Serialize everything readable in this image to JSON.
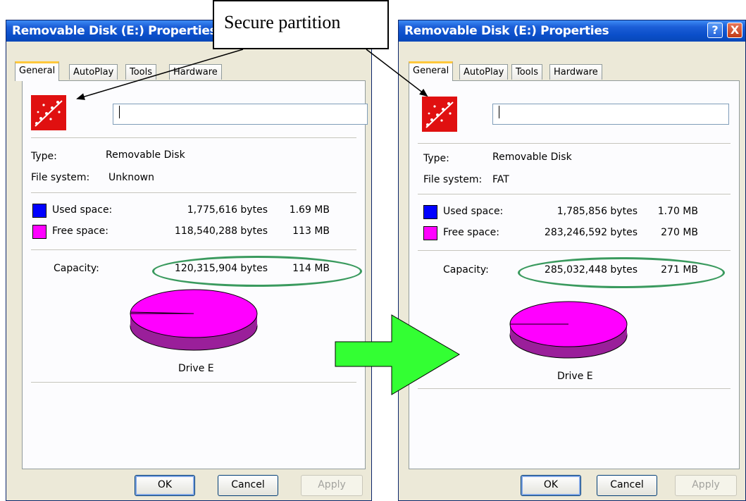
{
  "callout": {
    "text": "Secure partition"
  },
  "dialogs": [
    {
      "title": "Removable Disk (E:) Properties",
      "tabs": [
        "General",
        "AutoPlay",
        "Tools",
        "Hardware"
      ],
      "type_label": "Type:",
      "type_value": "Removable Disk",
      "fs_label": "File system:",
      "fs_value": "Unknown",
      "used_label": "Used space:",
      "used_bytes": "1,775,616 bytes",
      "used_mb": "1.69 MB",
      "free_label": "Free space:",
      "free_bytes": "118,540,288 bytes",
      "free_mb": "113 MB",
      "capacity_label": "Capacity:",
      "capacity_bytes": "120,315,904 bytes",
      "capacity_mb": "114 MB",
      "drive_label": "Drive E",
      "used_fraction": 0.0148,
      "ok": "OK",
      "cancel": "Cancel",
      "apply": "Apply"
    },
    {
      "title": "Removable Disk (E:) Properties",
      "tabs": [
        "General",
        "AutoPlay",
        "Tools",
        "Hardware"
      ],
      "type_label": "Type:",
      "type_value": "Removable Disk",
      "fs_label": "File system:",
      "fs_value": "FAT",
      "used_label": "Used space:",
      "used_bytes": "1,785,856 bytes",
      "used_mb": "1.70 MB",
      "free_label": "Free space:",
      "free_bytes": "283,246,592 bytes",
      "free_mb": "270 MB",
      "capacity_label": "Capacity:",
      "capacity_bytes": "285,032,448 bytes",
      "capacity_mb": "271 MB",
      "drive_label": "Drive E",
      "used_fraction": 0.0063,
      "ok": "OK",
      "cancel": "Cancel",
      "apply": "Apply",
      "help_icon": "?",
      "close_icon": "X"
    }
  ],
  "colors": {
    "used": "#0000ff",
    "free": "#ff00ff",
    "pie_side": "#9a1f9a",
    "ellipse": "#3a9a5e",
    "arrow_fill": "#33ff33"
  }
}
